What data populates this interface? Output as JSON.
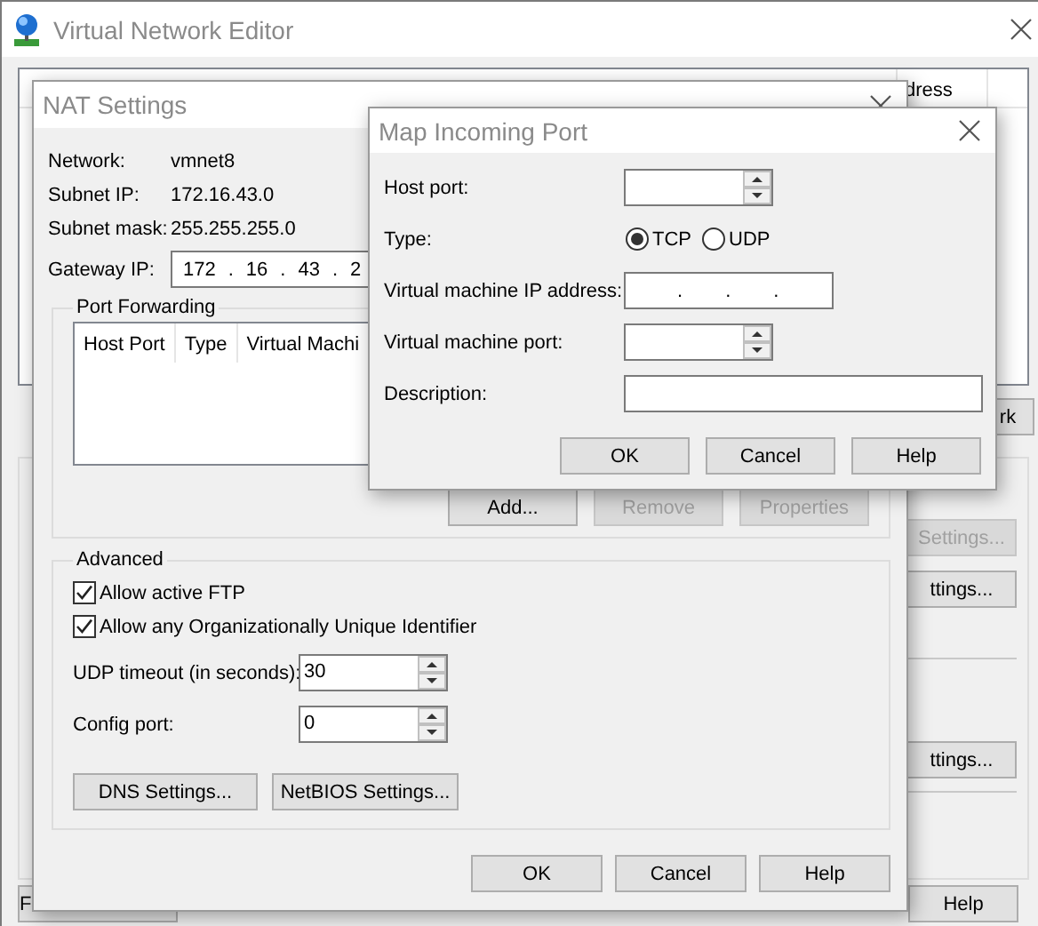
{
  "main_window": {
    "title": "Virtual Network Editor",
    "table": {
      "columns": [
        "dress"
      ]
    },
    "side_buttons": [
      {
        "label": "rk",
        "disabled": false
      },
      {
        "label": "Settings...",
        "disabled": true
      },
      {
        "label": "ttings...",
        "disabled": false
      },
      {
        "label": "ttings...",
        "disabled": false
      }
    ],
    "footer_buttons": [
      "F",
      "Help"
    ]
  },
  "nat_settings": {
    "title": "NAT Settings",
    "info": [
      {
        "label": "Network:",
        "value": "vmnet8"
      },
      {
        "label": "Subnet IP:",
        "value": "172.16.43.0"
      },
      {
        "label": "Subnet mask:",
        "value": "255.255.255.0"
      }
    ],
    "gateway_ip": {
      "label": "Gateway IP:",
      "octets": [
        "172",
        "16",
        "43",
        "2"
      ],
      "separator": "."
    },
    "port_forwarding": {
      "title": "Port Forwarding",
      "columns": [
        "Host Port",
        "Type",
        "Virtual Machi"
      ],
      "buttons": [
        {
          "label": "Add...",
          "disabled": false
        },
        {
          "label": "Remove",
          "disabled": true
        },
        {
          "label": "Properties",
          "disabled": true
        }
      ]
    },
    "advanced": {
      "title": "Advanced",
      "options": [
        {
          "label": "Allow active FTP",
          "checked": true
        },
        {
          "label": "Allow any Organizationally Unique Identifier",
          "checked": true
        }
      ],
      "spinners": [
        {
          "label": "UDP timeout (in seconds):",
          "value": "30"
        },
        {
          "label": "Config port:",
          "value": "0"
        }
      ],
      "buttons": [
        "DNS Settings...",
        "NetBIOS Settings..."
      ]
    },
    "buttons": [
      "OK",
      "Cancel",
      "Help"
    ]
  },
  "map_incoming_port": {
    "title": "Map Incoming Port",
    "host_port": {
      "label": "Host port:"
    },
    "type": {
      "label": "Type:",
      "options": [
        {
          "label": "TCP",
          "selected": true
        },
        {
          "label": "UDP",
          "selected": false
        }
      ]
    },
    "vm_ip": {
      "label": "Virtual machine IP address:",
      "separators": [
        ".",
        ".",
        "."
      ]
    },
    "vm_port": {
      "label": "Virtual machine port:"
    },
    "description": {
      "label": "Description:"
    },
    "buttons": [
      "OK",
      "Cancel",
      "Help"
    ]
  }
}
